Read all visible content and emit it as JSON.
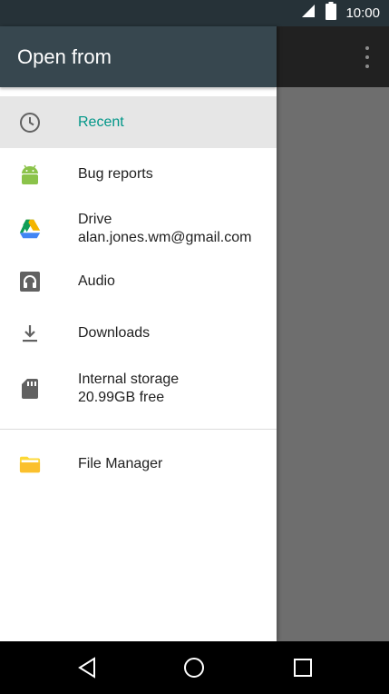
{
  "status_bar": {
    "time": "10:00",
    "icons": [
      "signal-icon",
      "battery-icon"
    ]
  },
  "drawer": {
    "title": "Open from",
    "items": [
      {
        "label": "Recent",
        "icon": "clock-icon",
        "selected": true
      },
      {
        "label": "Bug reports",
        "icon": "android-icon"
      },
      {
        "label": "Drive",
        "secondary": "alan.jones.wm@gmail.com",
        "icon": "google-drive-icon"
      },
      {
        "label": "Audio",
        "icon": "headphones-icon"
      },
      {
        "label": "Downloads",
        "icon": "download-icon"
      },
      {
        "label": "Internal storage",
        "secondary": "20.99GB free",
        "icon": "sd-card-icon"
      },
      {
        "label": "File Manager",
        "icon": "folder-icon"
      }
    ]
  },
  "app_bar": {
    "menu_icon": "overflow-menu-icon"
  },
  "nav_bar": {
    "buttons": [
      "back-icon",
      "home-icon",
      "recents-icon"
    ]
  },
  "colors": {
    "header": "#37474f",
    "status_bar": "#263238",
    "accent": "#009688",
    "selected_bg": "#e6e6e6"
  }
}
